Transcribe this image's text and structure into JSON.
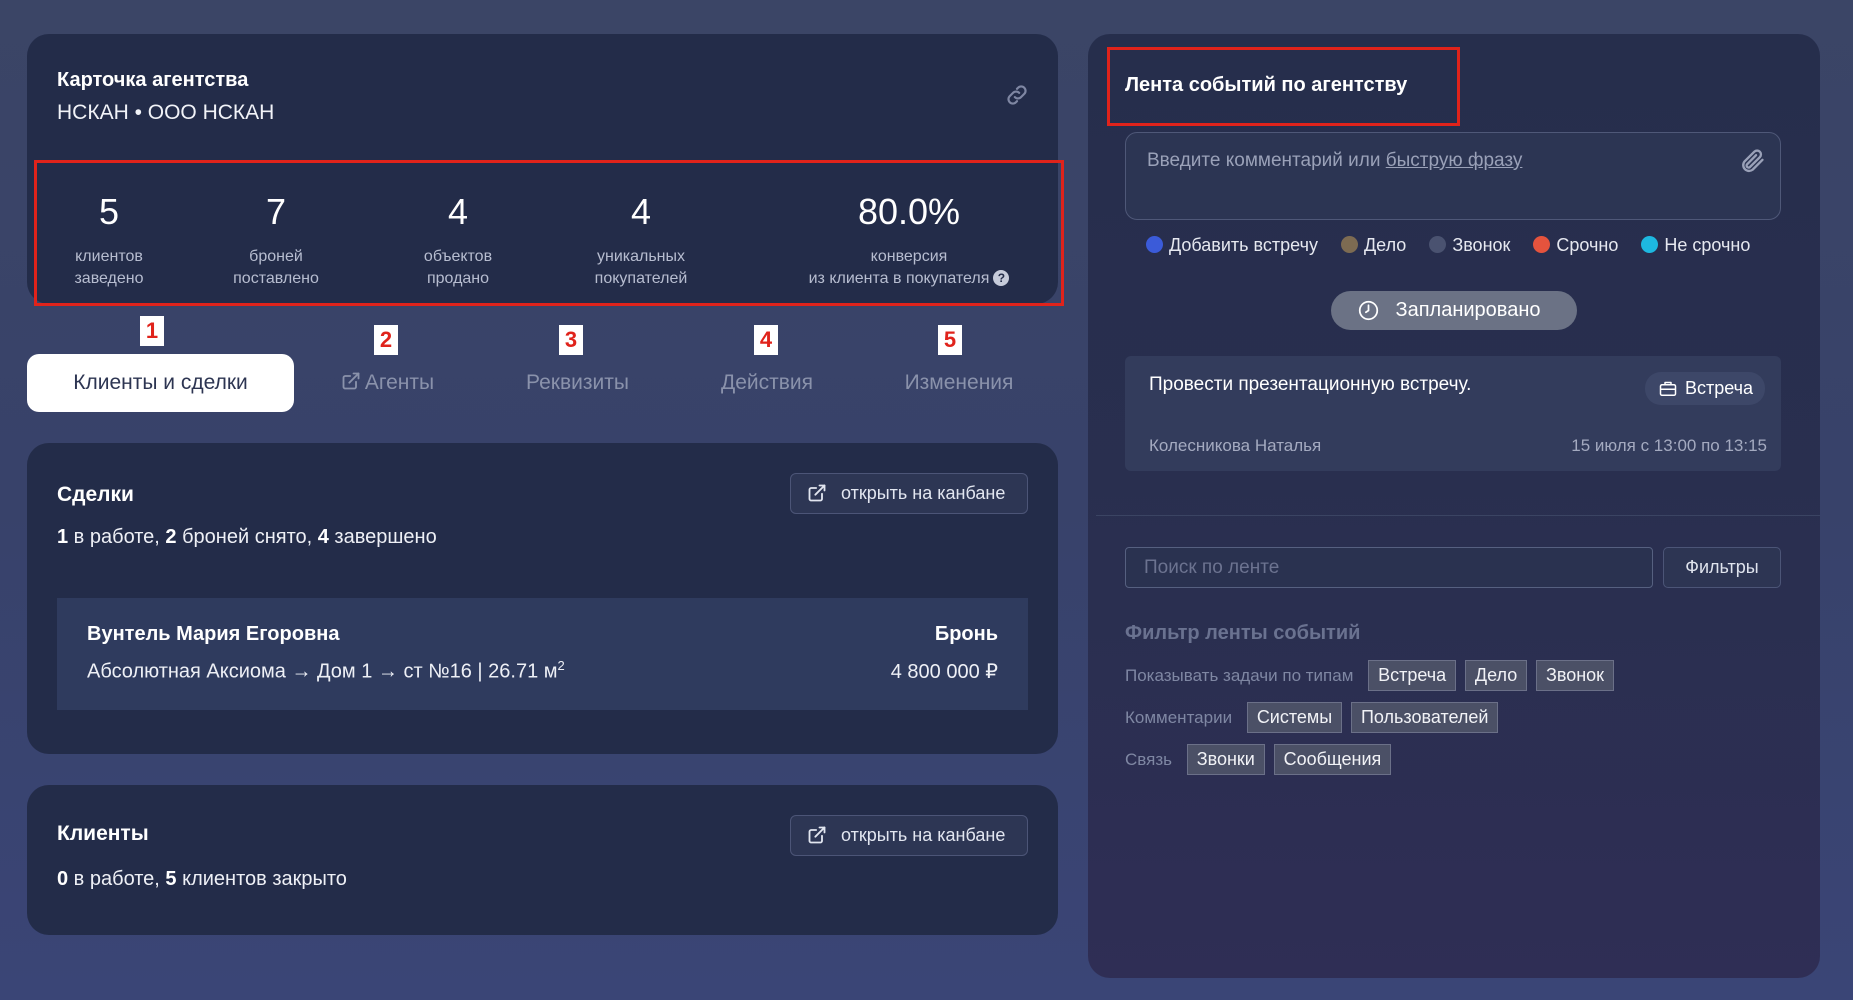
{
  "agency": {
    "title": "Карточка агентства",
    "subtitle": "НСКАН • ООО НСКАН",
    "stats": [
      {
        "value": "5",
        "label1": "клиентов",
        "label2": "заведено"
      },
      {
        "value": "7",
        "label1": "броней",
        "label2": "поставлено"
      },
      {
        "value": "4",
        "label1": "объектов",
        "label2": "продано"
      },
      {
        "value": "4",
        "label1": "уникальных",
        "label2": "покупателей"
      },
      {
        "value": "80.0%",
        "label1": "конверсия",
        "label2": "из клиента в покупателя"
      }
    ]
  },
  "tabs": [
    {
      "number": "1",
      "label": "Клиенты и сделки"
    },
    {
      "number": "2",
      "label": "Агенты"
    },
    {
      "number": "3",
      "label": "Реквизиты"
    },
    {
      "number": "4",
      "label": "Действия"
    },
    {
      "number": "5",
      "label": "Изменения"
    }
  ],
  "deals": {
    "title": "Сделки",
    "open_kanban": "открыть на канбане",
    "summary": {
      "in_work": "1",
      "in_work_label": " в работе, ",
      "removed": "2",
      "removed_label": " броней снято, ",
      "completed": "4",
      "completed_label": " завершено"
    },
    "card": {
      "client": "Вунтель Мария Егоровна",
      "object": "Абсолютная Аксиома → Дом 1 → ст №16 | 26.71 м",
      "object_sup": "2",
      "status": "Бронь",
      "price": "4 800 000 ₽"
    }
  },
  "clients": {
    "title": "Клиенты",
    "open_kanban": "открыть на канбане",
    "summary": {
      "in_work": "0",
      "in_work_label": " в работе, ",
      "closed": "5",
      "closed_label": " клиентов закрыто"
    }
  },
  "feed": {
    "title": "Лента событий по агентству",
    "comment_placeholder": "Введите комментарий или ",
    "comment_link": "быструю фразу",
    "tags": [
      {
        "label": "Добавить встречу",
        "color": "#3b5bd9"
      },
      {
        "label": "Дело",
        "color": "#7d6b52"
      },
      {
        "label": "Звонок",
        "color": "#4a5270"
      },
      {
        "label": "Срочно",
        "color": "#e5533d"
      },
      {
        "label": "Не срочно",
        "color": "#1db8e0"
      }
    ],
    "planned_label": "Запланировано",
    "event": {
      "text": "Провести презентационную встречу.",
      "type": "Встреча",
      "author": "Колесникова Наталья",
      "time": "15 июля с 13:00 по 13:15"
    },
    "search_placeholder": "Поиск по ленте",
    "filters_label": "Фильтры",
    "filter": {
      "title": "Фильтр ленты событий",
      "rows": [
        {
          "label": "Показывать задачи по типам",
          "chips": [
            "Встреча",
            "Дело",
            "Звонок"
          ]
        },
        {
          "label": "Комментарии",
          "chips": [
            "Системы",
            "Пользователей"
          ]
        },
        {
          "label": "Связь",
          "chips": [
            "Звонки",
            "Сообщения"
          ]
        }
      ]
    }
  }
}
